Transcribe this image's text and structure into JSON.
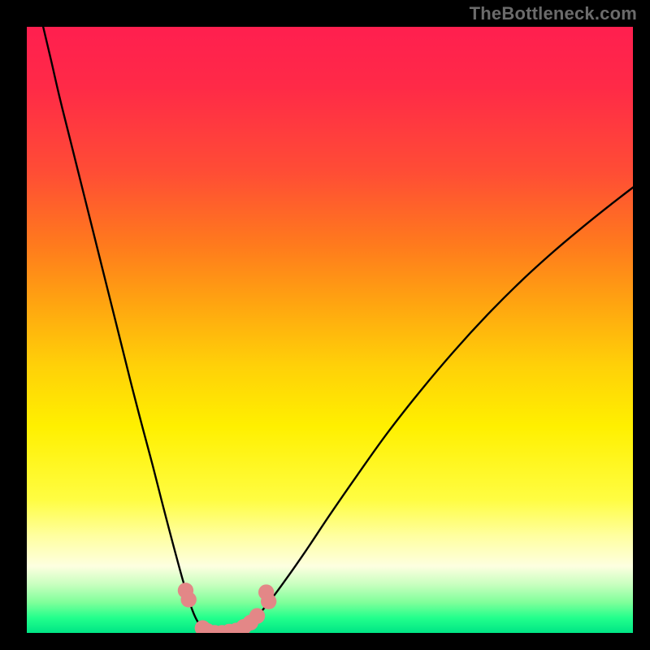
{
  "watermark": {
    "text": "TheBottleneck.com"
  },
  "chart_data": {
    "type": "line",
    "title": "",
    "xlabel": "",
    "ylabel": "",
    "xlim": [
      0,
      1
    ],
    "ylim": [
      0,
      1
    ],
    "background": {
      "gradient_stops": [
        {
          "pos": 0.0,
          "color": "#ff1f4f"
        },
        {
          "pos": 0.66,
          "color": "#fff000"
        },
        {
          "pos": 0.89,
          "color": "#fdffe0"
        },
        {
          "pos": 1.0,
          "color": "#00e585"
        }
      ]
    },
    "series": [
      {
        "name": "left-branch",
        "stroke": "#000000",
        "points": [
          {
            "x": 0.027,
            "y": 1.0
          },
          {
            "x": 0.04,
            "y": 0.945
          },
          {
            "x": 0.055,
            "y": 0.88
          },
          {
            "x": 0.075,
            "y": 0.8
          },
          {
            "x": 0.095,
            "y": 0.72
          },
          {
            "x": 0.115,
            "y": 0.64
          },
          {
            "x": 0.135,
            "y": 0.56
          },
          {
            "x": 0.155,
            "y": 0.48
          },
          {
            "x": 0.175,
            "y": 0.4
          },
          {
            "x": 0.192,
            "y": 0.335
          },
          {
            "x": 0.208,
            "y": 0.275
          },
          {
            "x": 0.222,
            "y": 0.22
          },
          {
            "x": 0.235,
            "y": 0.17
          },
          {
            "x": 0.247,
            "y": 0.125
          },
          {
            "x": 0.258,
            "y": 0.085
          },
          {
            "x": 0.268,
            "y": 0.052
          },
          {
            "x": 0.278,
            "y": 0.026
          },
          {
            "x": 0.288,
            "y": 0.01
          },
          {
            "x": 0.3,
            "y": 0.001
          },
          {
            "x": 0.312,
            "y": 0.0
          }
        ]
      },
      {
        "name": "right-branch",
        "stroke": "#000000",
        "points": [
          {
            "x": 0.312,
            "y": 0.0
          },
          {
            "x": 0.33,
            "y": 0.0
          },
          {
            "x": 0.348,
            "y": 0.004
          },
          {
            "x": 0.37,
            "y": 0.018
          },
          {
            "x": 0.395,
            "y": 0.045
          },
          {
            "x": 0.425,
            "y": 0.085
          },
          {
            "x": 0.46,
            "y": 0.135
          },
          {
            "x": 0.5,
            "y": 0.195
          },
          {
            "x": 0.545,
            "y": 0.26
          },
          {
            "x": 0.595,
            "y": 0.33
          },
          {
            "x": 0.65,
            "y": 0.4
          },
          {
            "x": 0.705,
            "y": 0.465
          },
          {
            "x": 0.76,
            "y": 0.525
          },
          {
            "x": 0.815,
            "y": 0.58
          },
          {
            "x": 0.87,
            "y": 0.63
          },
          {
            "x": 0.92,
            "y": 0.672
          },
          {
            "x": 0.965,
            "y": 0.708
          },
          {
            "x": 1.0,
            "y": 0.735
          }
        ]
      }
    ],
    "markers": {
      "color": "#e38787",
      "radius_norm": 0.013,
      "points": [
        {
          "x": 0.262,
          "y": 0.07
        },
        {
          "x": 0.267,
          "y": 0.055
        },
        {
          "x": 0.29,
          "y": 0.008
        },
        {
          "x": 0.298,
          "y": 0.003
        },
        {
          "x": 0.31,
          "y": 0.0
        },
        {
          "x": 0.322,
          "y": 0.0
        },
        {
          "x": 0.334,
          "y": 0.002
        },
        {
          "x": 0.346,
          "y": 0.004
        },
        {
          "x": 0.358,
          "y": 0.01
        },
        {
          "x": 0.369,
          "y": 0.017
        },
        {
          "x": 0.38,
          "y": 0.028
        },
        {
          "x": 0.395,
          "y": 0.067
        },
        {
          "x": 0.399,
          "y": 0.052
        }
      ]
    }
  }
}
